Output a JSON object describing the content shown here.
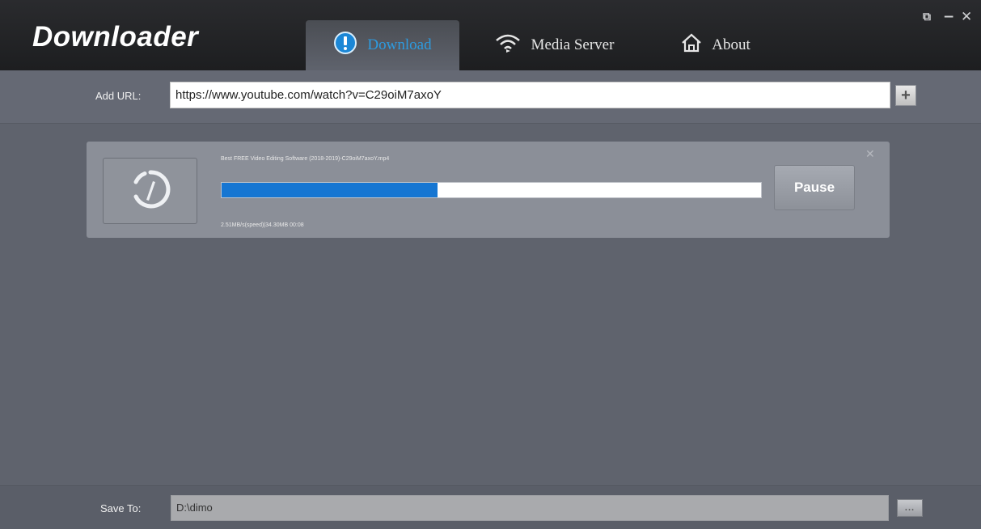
{
  "app": {
    "title": "Downloader"
  },
  "tabs": [
    {
      "label": "Download",
      "icon": "download-icon",
      "active": true
    },
    {
      "label": "Media Server",
      "icon": "wifi-icon",
      "active": false
    },
    {
      "label": "About",
      "icon": "home-icon",
      "active": false
    }
  ],
  "window_controls": {
    "restore": "⧉",
    "minimize": "−",
    "close": "✕"
  },
  "url_bar": {
    "label": "Add URL:",
    "value": "https://www.youtube.com/watch?v=C29oiM7axoY",
    "add_button": "+"
  },
  "download": {
    "file_name": "Best FREE Video Editing Software (2018-2019)-C29oiM7axoY.mp4",
    "progress": 0.4,
    "status": "2.51MB/s(speed)|34.30MB 00:08",
    "pause_label": "Pause",
    "close": "✕"
  },
  "save_to": {
    "label": "Save To:",
    "value": "D:\\dimo",
    "browse_label": "..."
  },
  "colors": {
    "accent": "#2d9be0",
    "progress": "#1676d2",
    "titlebar": "#1d1e20",
    "body": "#5f636d"
  }
}
